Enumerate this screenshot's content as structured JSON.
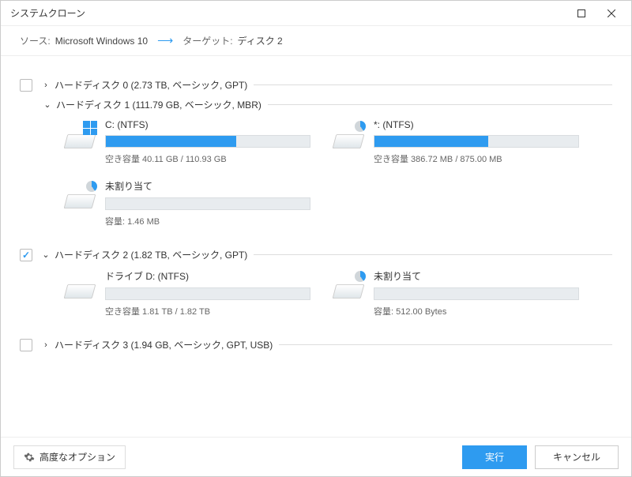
{
  "window": {
    "title": "システムクローン"
  },
  "header": {
    "source_label": "ソース:",
    "source_value": "Microsoft Windows 10",
    "target_label": "ターゲット:",
    "target_value": "ディスク 2"
  },
  "disks": [
    {
      "id": 0,
      "checked": false,
      "expanded": false,
      "label": "ハードディスク 0 (2.73 TB, ベーシック, GPT)",
      "partitions": []
    },
    {
      "id": 1,
      "checked": null,
      "expanded": true,
      "label": "ハードディスク 1 (111.79 GB, ベーシック, MBR)",
      "partitions": [
        {
          "name": "C: (NTFS)",
          "icon": "win",
          "fill_pct": 64,
          "sub": "空き容量 40.11 GB / 110.93 GB"
        },
        {
          "name": "*: (NTFS)",
          "icon": "pie",
          "fill_pct": 56,
          "sub": "空き容量 386.72 MB / 875.00 MB"
        },
        {
          "name": "未割り当て",
          "icon": "pie",
          "fill_pct": 0,
          "sub": "容量: 1.46 MB"
        }
      ]
    },
    {
      "id": 2,
      "checked": true,
      "expanded": true,
      "label": "ハードディスク 2 (1.82 TB, ベーシック, GPT)",
      "partitions": [
        {
          "name": "ドライブ D: (NTFS)",
          "icon": "plain",
          "fill_pct": 0,
          "sub": "空き容量 1.81 TB / 1.82 TB"
        },
        {
          "name": "未割り当て",
          "icon": "pie",
          "fill_pct": 0,
          "sub": "容量: 512.00 Bytes"
        }
      ]
    },
    {
      "id": 3,
      "checked": false,
      "expanded": false,
      "label": "ハードディスク 3 (1.94 GB, ベーシック, GPT, USB)",
      "partitions": []
    }
  ],
  "footer": {
    "advanced": "高度なオプション",
    "run": "実行",
    "cancel": "キャンセル"
  }
}
